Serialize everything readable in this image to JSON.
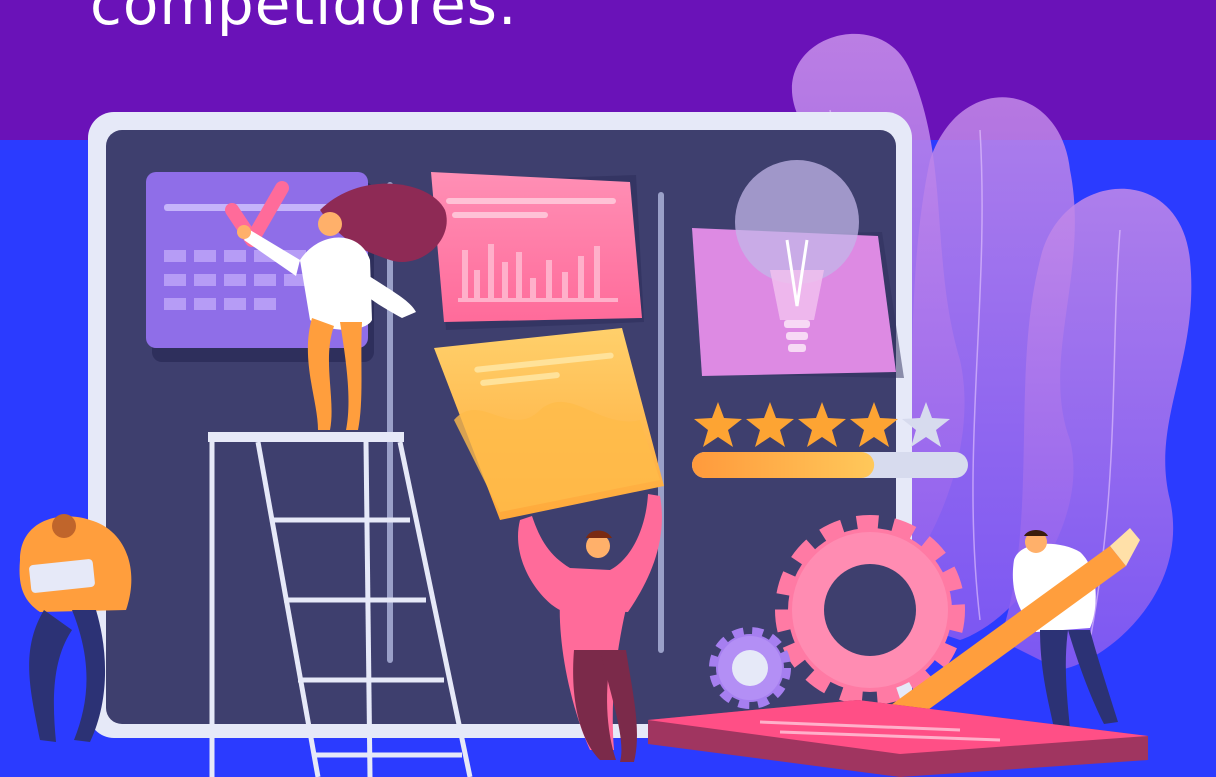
{
  "headline": {
    "text": "competidores."
  },
  "rating": {
    "filled_stars": 4,
    "total_stars": 5,
    "progress_fraction": 0.66
  },
  "colors": {
    "top_band": "#6a12b8",
    "background": "#2b3bff",
    "board": "#3e3f6e",
    "board_frame": "#e6e9f8",
    "accent_pink": "#ff6fa0",
    "accent_orange": "#ffb347",
    "accent_purple": "#9f75ea",
    "star_gold": "#fda433"
  }
}
